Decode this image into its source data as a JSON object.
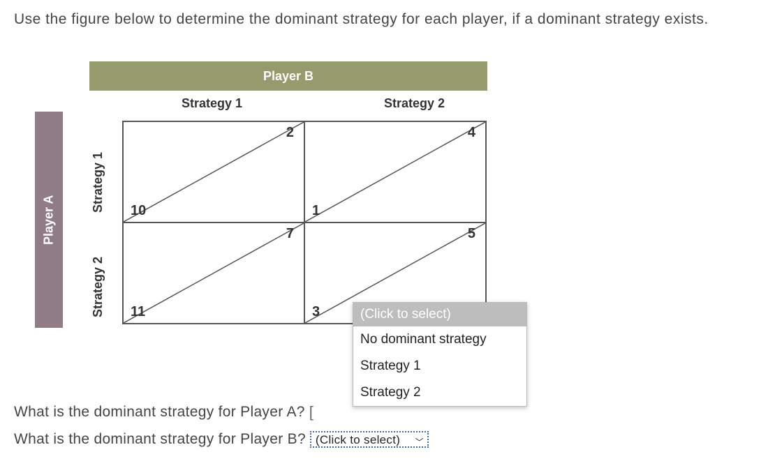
{
  "prompt": "Use the figure below to determine the dominant strategy for each player, if a dominant strategy exists.",
  "players": {
    "row": "Player A",
    "col": "Player B",
    "row_strategies": [
      "Strategy 1",
      "Strategy 2"
    ],
    "col_strategies": [
      "Strategy 1",
      "Strategy 2"
    ]
  },
  "payoffs": {
    "r1c1": {
      "top_right": "2",
      "bottom_left": "10"
    },
    "r1c2": {
      "top_right": "4",
      "bottom_left": "1"
    },
    "r2c1": {
      "top_right": "7",
      "bottom_left": "11"
    },
    "r2c2": {
      "top_right": "5",
      "bottom_left": "3"
    }
  },
  "dropdown": {
    "header": "(Click to select)",
    "options": [
      "No dominant strategy",
      "Strategy 1",
      "Strategy 2"
    ]
  },
  "questions": {
    "qA": "What is the dominant strategy for Player A?",
    "qB": "What is the dominant strategy for Player B?",
    "select_placeholder": "(Click to select)"
  }
}
